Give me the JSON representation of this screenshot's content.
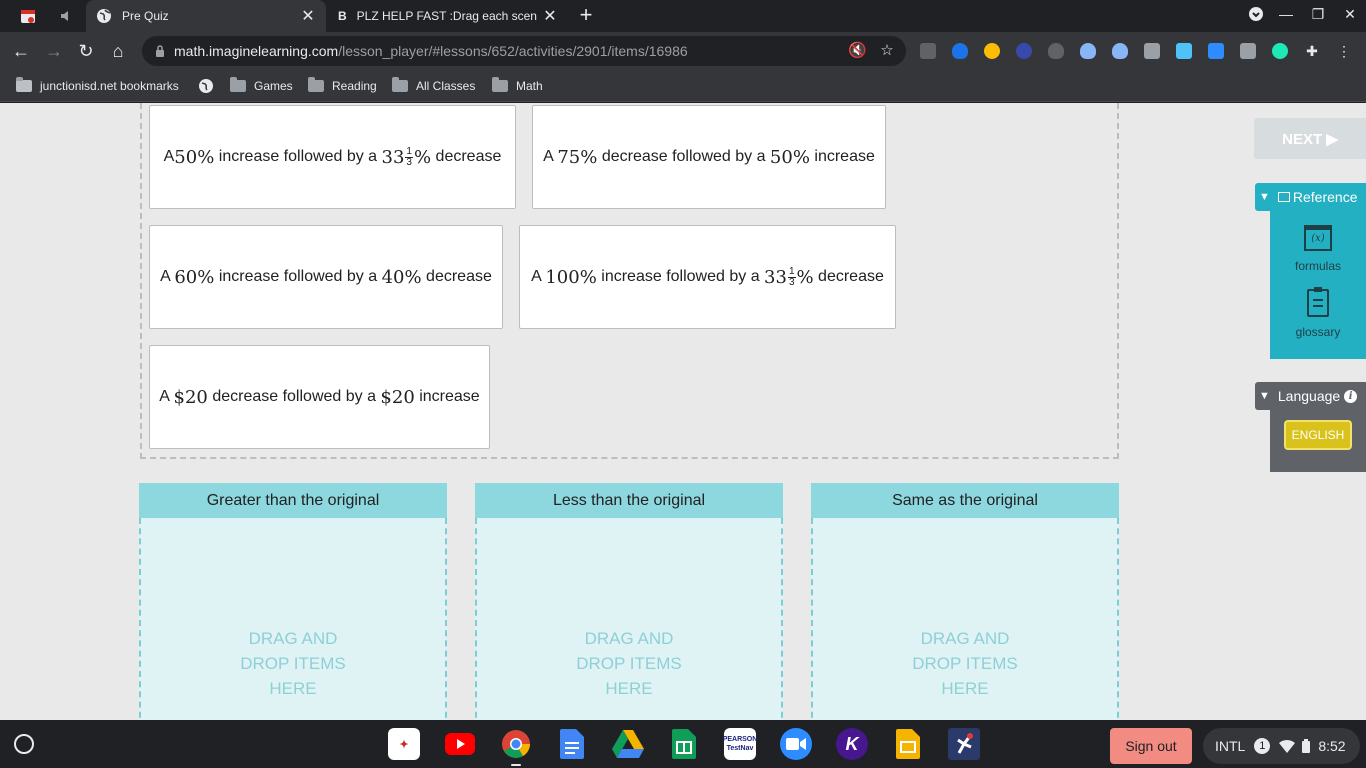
{
  "browser": {
    "tabs": [
      {
        "title": "Pre Quiz",
        "active": true
      },
      {
        "title": "PLZ HELP FAST :Drag each scen",
        "active": false
      }
    ],
    "url_host": "math.imaginelearning.com",
    "url_path": "/lesson_player/#lessons/652/activities/2901/items/16986",
    "bookmarks": [
      {
        "label": "junctionisd.net bookmarks"
      },
      {
        "label": "Games"
      },
      {
        "label": "Reading"
      },
      {
        "label": "All Classes"
      },
      {
        "label": "Math"
      }
    ]
  },
  "cards": [
    {
      "pre": "A ",
      "m1": "50%",
      "mid": " increase followed by a ",
      "whole": "33",
      "fnum": "1",
      "fden": "3",
      "pct": "%",
      "post": " decrease"
    },
    {
      "pre": "A ",
      "m1": "75%",
      "mid": " decrease followed by a ",
      "m2": "50%",
      "post": " increase"
    },
    {
      "pre": "A ",
      "m1": "60%",
      "mid": " increase followed by a ",
      "m2": "40%",
      "post": " decrease"
    },
    {
      "pre": "A ",
      "m1": "100%",
      "mid": " increase followed by a ",
      "whole": "33",
      "fnum": "1",
      "fden": "3",
      "pct": "%",
      "post": " decrease"
    },
    {
      "pre": "A ",
      "m1": "$20",
      "mid": " decrease followed by a ",
      "m2": "$20",
      "post": " increase"
    }
  ],
  "bins": [
    {
      "title": "Greater than the original",
      "hint_lines": [
        "DRAG AND",
        "DROP ITEMS",
        "HERE"
      ]
    },
    {
      "title": "Less than the original",
      "hint_lines": [
        "DRAG AND",
        "DROP ITEMS",
        "HERE"
      ]
    },
    {
      "title": "Same as the original",
      "hint_lines": [
        "DRAG AND",
        "DROP ITEMS",
        "HERE"
      ]
    }
  ],
  "sidebar": {
    "next_label": "NEXT ▶",
    "reference_label": "Reference",
    "formulas_label": "formulas",
    "formulas_glyph": "(x)",
    "glossary_label": "glossary",
    "language_label": "Language",
    "english_label": "ENGLISH"
  },
  "shelf": {
    "signout_label": "Sign out",
    "ime": "INTL",
    "notif_count": "1",
    "time": "8:52",
    "apps": [
      {
        "name": "education-app-icon",
        "color": "#ffffff"
      },
      {
        "name": "youtube-icon",
        "color": "#ff0000"
      },
      {
        "name": "chrome-icon",
        "color": "#4285f4"
      },
      {
        "name": "docs-icon",
        "color": "#4285f4"
      },
      {
        "name": "drive-icon",
        "color": "#0f9d58"
      },
      {
        "name": "sheets-icon",
        "color": "#0f9d58"
      },
      {
        "name": "testnav-icon",
        "color": "#ffffff"
      },
      {
        "name": "zoom-icon",
        "color": "#2d8cff"
      },
      {
        "name": "kahoot-icon",
        "color": "#46178f"
      },
      {
        "name": "slides-icon",
        "color": "#f4b400"
      },
      {
        "name": "game-app-icon",
        "color": "#2a3a6a"
      }
    ],
    "apps_text": {
      "testnav": "PEARSON TestNav",
      "kahoot": "K"
    }
  },
  "colors": {
    "accent_teal": "#24b0c3",
    "bin_header": "#8dd7df",
    "english_button": "#d9c21b",
    "signout": "#f28b82"
  }
}
